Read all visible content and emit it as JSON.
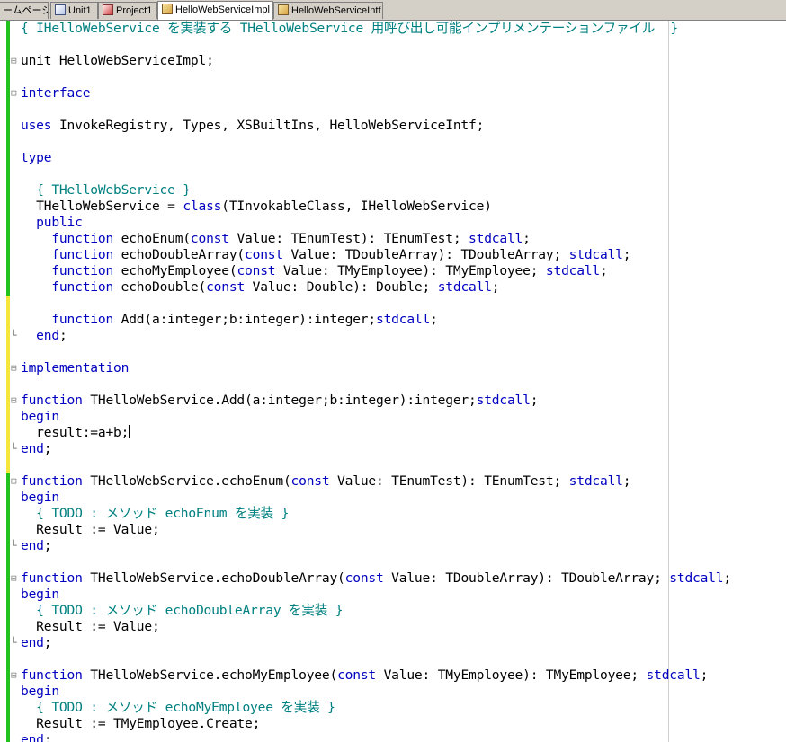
{
  "tabs": [
    {
      "label": "ームページ",
      "icon": "none",
      "active": false
    },
    {
      "label": "Unit1",
      "icon": "unit",
      "active": false
    },
    {
      "label": "Project1",
      "icon": "project",
      "active": false
    },
    {
      "label": "HelloWebServiceImpl",
      "icon": "file",
      "active": true
    },
    {
      "label": "HelloWebServiceIntf",
      "icon": "file",
      "active": false
    }
  ],
  "code_lines": [
    [
      [
        "cm",
        "{ IHelloWebService を実装する THelloWebService 用呼び出し可能インプリメンテーションファイル  }"
      ]
    ],
    [],
    [
      [
        "tx",
        "unit HelloWebServiceImpl;"
      ]
    ],
    [],
    [
      [
        "kw",
        "interface"
      ]
    ],
    [],
    [
      [
        "kw",
        "uses"
      ],
      [
        "tx",
        " InvokeRegistry, Types, XSBuiltIns, HelloWebServiceIntf;"
      ]
    ],
    [],
    [
      [
        "kw",
        "type"
      ]
    ],
    [],
    [
      [
        "cm",
        "  { THelloWebService }"
      ]
    ],
    [
      [
        "tx",
        "  THelloWebService = "
      ],
      [
        "kw",
        "class"
      ],
      [
        "tx",
        "(TInvokableClass, IHelloWebService)"
      ]
    ],
    [
      [
        "kw",
        "  public"
      ]
    ],
    [
      [
        "kw",
        "    function"
      ],
      [
        "tx",
        " echoEnum("
      ],
      [
        "kw",
        "const"
      ],
      [
        "tx",
        " Value: TEnumTest): TEnumTest; "
      ],
      [
        "kw",
        "stdcall"
      ],
      [
        "tx",
        ";"
      ]
    ],
    [
      [
        "kw",
        "    function"
      ],
      [
        "tx",
        " echoDoubleArray("
      ],
      [
        "kw",
        "const"
      ],
      [
        "tx",
        " Value: TDoubleArray): TDoubleArray; "
      ],
      [
        "kw",
        "stdcall"
      ],
      [
        "tx",
        ";"
      ]
    ],
    [
      [
        "kw",
        "    function"
      ],
      [
        "tx",
        " echoMyEmployee("
      ],
      [
        "kw",
        "const"
      ],
      [
        "tx",
        " Value: TMyEmployee): TMyEmployee; "
      ],
      [
        "kw",
        "stdcall"
      ],
      [
        "tx",
        ";"
      ]
    ],
    [
      [
        "kw",
        "    function"
      ],
      [
        "tx",
        " echoDouble("
      ],
      [
        "kw",
        "const"
      ],
      [
        "tx",
        " Value: Double): Double; "
      ],
      [
        "kw",
        "stdcall"
      ],
      [
        "tx",
        ";"
      ]
    ],
    [],
    [
      [
        "kw",
        "    function"
      ],
      [
        "tx",
        " Add(a:integer;b:integer):integer;"
      ],
      [
        "kw",
        "stdcall"
      ],
      [
        "tx",
        ";"
      ]
    ],
    [
      [
        "kw",
        "  end"
      ],
      [
        "tx",
        ";"
      ]
    ],
    [],
    [
      [
        "kw",
        "implementation"
      ]
    ],
    [],
    [
      [
        "kw",
        "function"
      ],
      [
        "tx",
        " THelloWebService.Add(a:integer;b:integer):integer;"
      ],
      [
        "kw",
        "stdcall"
      ],
      [
        "tx",
        ";"
      ]
    ],
    [
      [
        "kw",
        "begin"
      ]
    ],
    [
      [
        "tx",
        "  result:=a+b;"
      ]
    ],
    [
      [
        "kw",
        "end"
      ],
      [
        "tx",
        ";"
      ]
    ],
    [],
    [
      [
        "kw",
        "function"
      ],
      [
        "tx",
        " THelloWebService.echoEnum("
      ],
      [
        "kw",
        "const"
      ],
      [
        "tx",
        " Value: TEnumTest): TEnumTest; "
      ],
      [
        "kw",
        "stdcall"
      ],
      [
        "tx",
        ";"
      ]
    ],
    [
      [
        "kw",
        "begin"
      ]
    ],
    [
      [
        "cm",
        "  { TODO : メソッド echoEnum を実装 }"
      ]
    ],
    [
      [
        "tx",
        "  Result := Value;"
      ]
    ],
    [
      [
        "kw",
        "end"
      ],
      [
        "tx",
        ";"
      ]
    ],
    [],
    [
      [
        "kw",
        "function"
      ],
      [
        "tx",
        " THelloWebService.echoDoubleArray("
      ],
      [
        "kw",
        "const"
      ],
      [
        "tx",
        " Value: TDoubleArray): TDoubleArray; "
      ],
      [
        "kw",
        "stdcall"
      ],
      [
        "tx",
        ";"
      ]
    ],
    [
      [
        "kw",
        "begin"
      ]
    ],
    [
      [
        "cm",
        "  { TODO : メソッド echoDoubleArray を実装 }"
      ]
    ],
    [
      [
        "tx",
        "  Result := Value;"
      ]
    ],
    [
      [
        "kw",
        "end"
      ],
      [
        "tx",
        ";"
      ]
    ],
    [],
    [
      [
        "kw",
        "function"
      ],
      [
        "tx",
        " THelloWebService.echoMyEmployee("
      ],
      [
        "kw",
        "const"
      ],
      [
        "tx",
        " Value: TMyEmployee): TMyEmployee; "
      ],
      [
        "kw",
        "stdcall"
      ],
      [
        "tx",
        ";"
      ]
    ],
    [
      [
        "kw",
        "begin"
      ]
    ],
    [
      [
        "cm",
        "  { TODO : メソッド echoMyEmployee を実装 }"
      ]
    ],
    [
      [
        "tx",
        "  Result := TMyEmployee.Create;"
      ]
    ],
    [
      [
        "kw",
        "end"
      ],
      [
        "tx",
        ";"
      ]
    ]
  ],
  "fold_markers": {
    "2": "⊟",
    "4": "⊟",
    "19": "└",
    "21": "⊟",
    "23": "⊟",
    "26": "└",
    "28": "⊟",
    "32": "└",
    "34": "⊟",
    "38": "└",
    "40": "⊟"
  },
  "change_bars": [
    {
      "from": 0,
      "to": 17,
      "state": "saved"
    },
    {
      "from": 17,
      "to": 28,
      "state": "modified"
    },
    {
      "from": 28,
      "to": 45,
      "state": "saved"
    }
  ],
  "caret_line": 25,
  "colors": {
    "keyword": "#0000c0",
    "comment": "#008080",
    "text": "#000000",
    "saved_bar": "#22c21e",
    "modified_bar": "#f5e63a"
  }
}
